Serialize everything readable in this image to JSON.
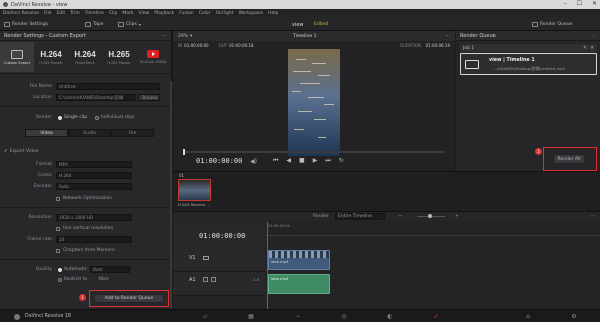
{
  "window": {
    "title": "DaVinci Resolve - view",
    "controls": [
      "–",
      "☐",
      "✕"
    ]
  },
  "menu": [
    "DaVinci Resolve",
    "File",
    "Edit",
    "Trim",
    "Timeline",
    "Clip",
    "Mark",
    "View",
    "Playback",
    "Fusion",
    "Color",
    "Fairlight",
    "Workspace",
    "Help"
  ],
  "toolbar": {
    "render_settings": "Render Settings",
    "tape": "Tape",
    "clips": "Clips",
    "project_name": "view",
    "edited": "Edited",
    "render_queue": "Render Queue"
  },
  "render_settings": {
    "header": "Render Settings - Custom Export",
    "presets": [
      {
        "big": "",
        "label": "Custom Export",
        "icon": "film-icon"
      },
      {
        "big": "H.264",
        "label": "H.264 Master"
      },
      {
        "big": "H.264",
        "label": "HyperDeck"
      },
      {
        "big": "H.265",
        "label": "H.265 Master"
      },
      {
        "big": "",
        "label": "YouTube 1080p",
        "icon": "youtube-icon"
      }
    ],
    "file_name_label": "File Name",
    "file_name": "Untitled",
    "location_label": "Location",
    "location": "C:\\Users\\HUAWEI\\Desktop\\剪辑",
    "browse": "Browse",
    "render_label": "Render",
    "single_clip": "Single clip",
    "individual_clips": "Individual clips",
    "tabs": [
      "Video",
      "Audio",
      "File"
    ],
    "export_video": "Export Video",
    "format_label": "Format",
    "format": "MP4",
    "codec_label": "Codec",
    "codec": "H.264",
    "encoder_label": "Encoder",
    "encoder": "Auto",
    "network_opt": "Network Optimization",
    "resolution_label": "Resolution",
    "resolution": "1920 x 1080 HD",
    "vertical_res": "Use vertical resolution",
    "frame_rate_label": "Frame rate",
    "frame_rate": "24",
    "chapters": "Chapters from Markers",
    "quality_label": "Quality",
    "quality_auto": "Automatic",
    "quality_best": "Best",
    "restrict_to": "Restrict to",
    "kbs": "Kb/s",
    "add_to_queue": "Add to Render Queue",
    "badge": "1"
  },
  "viewer": {
    "zoom": "29%",
    "timeline_name": "Timeline 1",
    "in_label": "IN",
    "in_tc": "01:00:00:00",
    "out_label": "OUT",
    "out_tc": "01:00:06:18",
    "duration_label": "DURATION",
    "duration_tc": "01:00:06:19",
    "current_tc": "01:00:00:00"
  },
  "render_queue": {
    "header": "Render Queue",
    "job_label": "Job 1",
    "job_title": "view | Timeline 1",
    "job_path": "...\\HUAWEI\\Desktop\\剪辑\\Untitled.mp4",
    "render_all": "Render All",
    "badge": "2"
  },
  "media": {
    "clip_id": "01",
    "thumb_label": "H.264 Resolve ..."
  },
  "timeline": {
    "render_label": "Render",
    "render_value": "Entire Timeline",
    "timecode": "01:00:00:00",
    "ruler_start": "01:00:00:00",
    "v1": "V1",
    "a1": "A1",
    "a1_level": "2.0",
    "video_clip": "lake.mp4",
    "audio_clip": "lake.mp4"
  },
  "pages": {
    "app_name": "DaVinci Resolve 18"
  },
  "colors": {
    "accent_red": "#e03030",
    "audio_clip": "#3f8b66",
    "video_clip": "#4a7fb0"
  }
}
